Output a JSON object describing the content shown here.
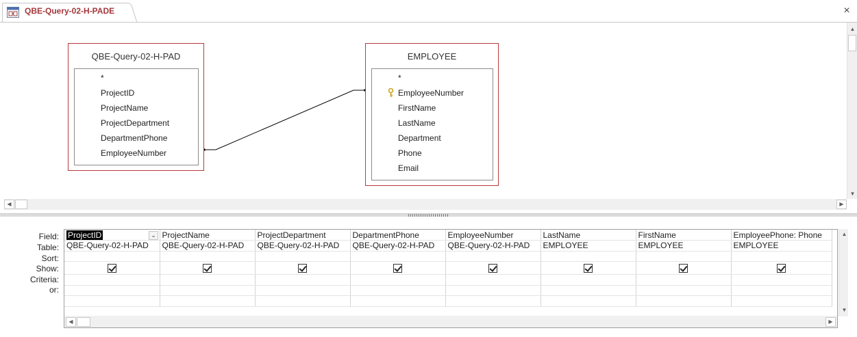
{
  "tab": {
    "title": "QBE-Query-02-H-PADE",
    "icon": "query-design-icon",
    "close_glyph": "×"
  },
  "colors": {
    "table_border": "#b9393c",
    "tab_text": "#a4373a",
    "key_icon": "#c9a41f"
  },
  "tables": [
    {
      "title": "QBE-Query-02-H-PAD",
      "fields": [
        "*",
        "ProjectID",
        "ProjectName",
        "ProjectDepartment",
        "DepartmentPhone",
        "EmployeeNumber"
      ],
      "key_field": null
    },
    {
      "title": "EMPLOYEE",
      "fields": [
        "*",
        "EmployeeNumber",
        "FirstName",
        "LastName",
        "Department",
        "Phone",
        "Email"
      ],
      "key_field": "EmployeeNumber"
    }
  ],
  "relationship": {
    "from": "EmployeeNumber",
    "to": "EmployeeNumber"
  },
  "grid": {
    "row_labels": [
      "Field:",
      "Table:",
      "Sort:",
      "Show:",
      "Criteria:",
      "or:"
    ],
    "columns": [
      {
        "field": "ProjectID",
        "table": "QBE-Query-02-H-PAD",
        "show": true
      },
      {
        "field": "ProjectName",
        "table": "QBE-Query-02-H-PAD",
        "show": true
      },
      {
        "field": "ProjectDepartment",
        "table": "QBE-Query-02-H-PAD",
        "show": true
      },
      {
        "field": "DepartmentPhone",
        "table": "QBE-Query-02-H-PAD",
        "show": true
      },
      {
        "field": "EmployeeNumber",
        "table": "QBE-Query-02-H-PAD",
        "show": true
      },
      {
        "field": "LastName",
        "table": "EMPLOYEE",
        "show": true
      },
      {
        "field": "FirstName",
        "table": "EMPLOYEE",
        "show": true
      },
      {
        "field": "EmployeePhone: Phone",
        "table": "EMPLOYEE",
        "show": true
      }
    ]
  }
}
